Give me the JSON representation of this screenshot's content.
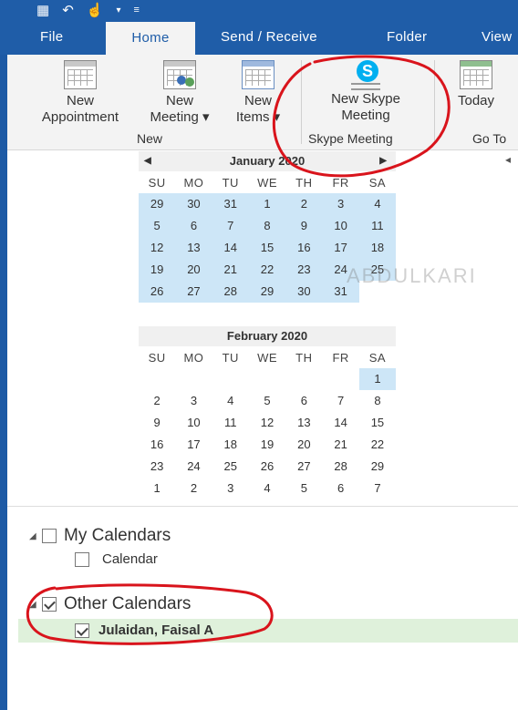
{
  "tabs": [
    "File",
    "Home",
    "Send / Receive",
    "Folder",
    "View"
  ],
  "ribbon": {
    "new_appointment": [
      "New",
      "Appointment"
    ],
    "new_meeting": [
      "New",
      "Meeting ▾"
    ],
    "new_items": [
      "New",
      "Items ▾"
    ],
    "group_new": "New",
    "new_skype_meeting": [
      "New Skype",
      "Meeting"
    ],
    "group_skype": "Skype Meeting",
    "today": "Today",
    "group_goto": "Go To"
  },
  "calendar": {
    "dow": [
      "SU",
      "MO",
      "TU",
      "WE",
      "TH",
      "FR",
      "SA"
    ],
    "months": [
      {
        "title": "January 2020",
        "weeks": [
          [
            "29",
            "30",
            "31",
            "1",
            "2",
            "3",
            "4"
          ],
          [
            "5",
            "6",
            "7",
            "8",
            "9",
            "10",
            "11"
          ],
          [
            "12",
            "13",
            "14",
            "15",
            "16",
            "17",
            "18"
          ],
          [
            "19",
            "20",
            "21",
            "22",
            "23",
            "24",
            "25"
          ],
          [
            "26",
            "27",
            "28",
            "29",
            "30",
            "31",
            ""
          ]
        ]
      },
      {
        "title": "February 2020",
        "weeks": [
          [
            "",
            "",
            "",
            "",
            "",
            "",
            "1"
          ],
          [
            "2",
            "3",
            "4",
            "5",
            "6",
            "7",
            "8"
          ],
          [
            "9",
            "10",
            "11",
            "12",
            "13",
            "14",
            "15"
          ],
          [
            "16",
            "17",
            "18",
            "19",
            "20",
            "21",
            "22"
          ],
          [
            "23",
            "24",
            "25",
            "26",
            "27",
            "28",
            "29"
          ],
          [
            "1",
            "2",
            "3",
            "4",
            "5",
            "6",
            "7"
          ]
        ]
      }
    ]
  },
  "watermark": "ABDULKARI",
  "folders": {
    "my_calendars": "My Calendars",
    "calendar": "Calendar",
    "other_calendars": "Other Calendars",
    "shared_calendar": "Julaidan, Faisal A"
  },
  "colors": {
    "titlebar": "#1f5da8",
    "selection_blue": "#cde6f7",
    "selected_row": "#dff1db",
    "annotation_red": "#d9141c"
  }
}
